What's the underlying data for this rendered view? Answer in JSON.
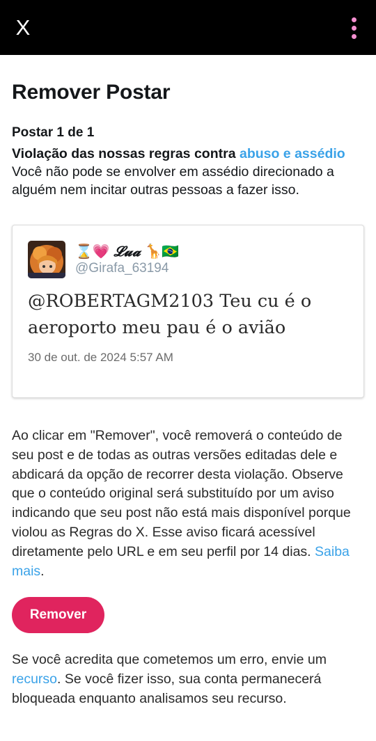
{
  "topbar": {
    "close_label": "X",
    "menu_icon": "kebab-menu-icon",
    "background": "#000000",
    "menu_color": "#f48fd0"
  },
  "page": {
    "title": "Remover Postar",
    "post_count": "Postar 1 de 1",
    "violation_prefix": "Violação das nossas regras contra",
    "violation_link": "abuso e assédio",
    "violation_description": "Você não pode se envolver em assédio direcionado a alguém nem incitar outras pessoas a fazer isso."
  },
  "tweet": {
    "display_name_prefix": "⌛💗",
    "display_name_script": "𝓛𝓾𝓪",
    "display_name_suffix": "🦒🇧🇷",
    "handle": "@Girafa_63194",
    "text": "@ROBERTAGM2103 Teu cu é o aeroporto meu pau é o avião",
    "timestamp": "30 de out. de 2024 5:57 AM"
  },
  "explanation": {
    "text": "Ao clicar em \"Remover\", você removerá o conteúdo de seu post e de todas as outras versões editadas dele e abdicará da opção de recorrer desta violação. Observe que o conteúdo original será substituído por um aviso indicando que seu post não está mais disponível porque violou as Regras do X. Esse aviso ficará acessível diretamente pelo URL e em seu perfil por 14 dias.",
    "link": "Saiba mais",
    "end": "."
  },
  "remove_button": {
    "label": "Remover",
    "color": "#e0245e"
  },
  "appeal": {
    "prefix": "Se você acredita que cometemos um erro, envie um",
    "link": "recurso",
    "suffix": ". Se você fizer isso, sua conta permanecerá bloqueada enquanto analisamos seu recurso."
  },
  "colors": {
    "link": "#3aa2e8",
    "text": "#14171a",
    "muted": "#8a9aa8"
  }
}
